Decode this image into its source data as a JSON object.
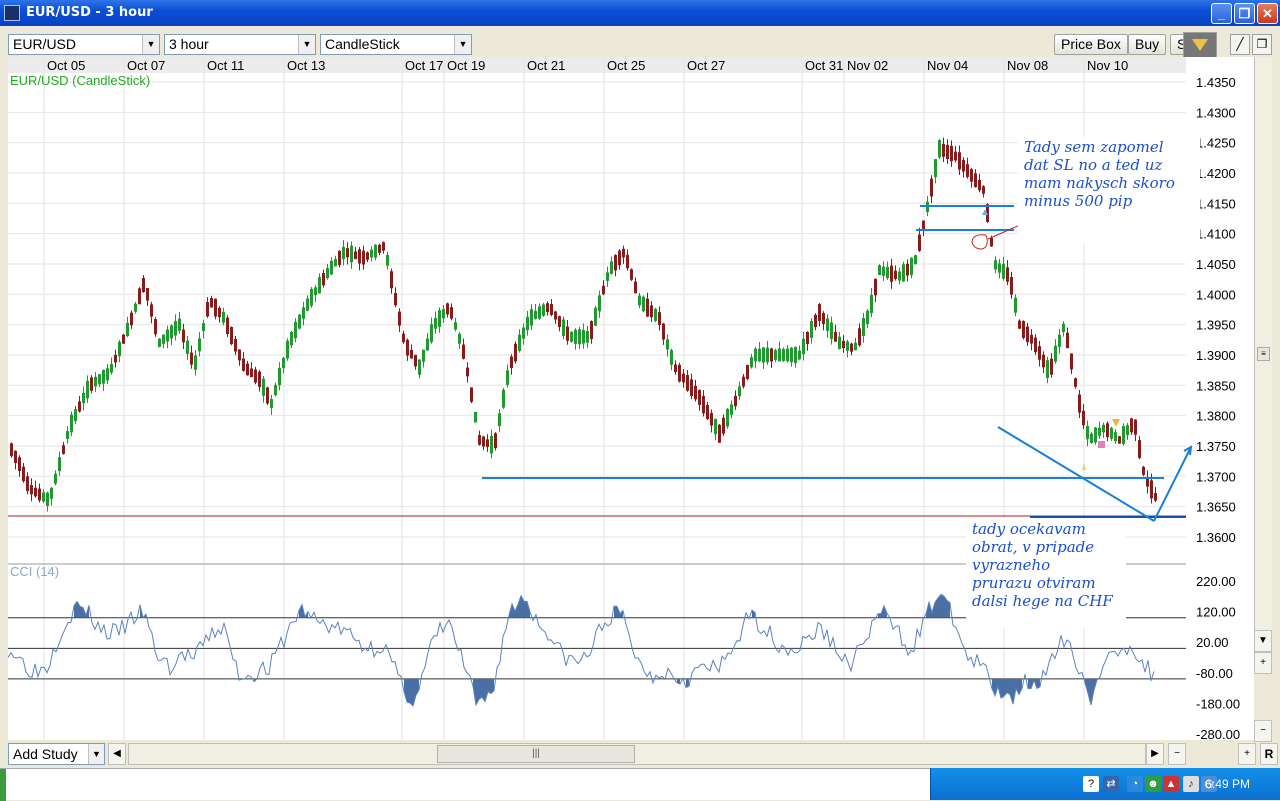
{
  "window": {
    "title": "EUR/USD - 3 hour"
  },
  "toolbar": {
    "symbol": "EUR/USD",
    "interval": "3 hour",
    "chart_type": "CandleStick",
    "price_box": "Price Box",
    "buy": "Buy",
    "sell": "Sell"
  },
  "chart": {
    "main_label": "EUR/USD (CandleStick)",
    "indicator_label": "CCI (14)",
    "date_labels": [
      "Oct 05",
      "Oct 07",
      "Oct 11",
      "Oct 13",
      "Oct 17",
      "Oct 19",
      "Oct 21",
      "Oct 25",
      "Oct 27",
      "Oct 31",
      "Nov 02",
      "Nov 04",
      "Nov 08",
      "Nov 10"
    ],
    "price_ticks": [
      "1.4350",
      "1.4300",
      "1.4250",
      "1.4200",
      "1.4150",
      "1.4100",
      "1.4050",
      "1.4000",
      "1.3950",
      "1.3900",
      "1.3850",
      "1.3800",
      "1.3750",
      "1.3700",
      "1.3650",
      "1.3600"
    ],
    "cci_ticks": [
      "220.00",
      "120.00",
      "20.00",
      "-80.00",
      "-180.00",
      "-280.00"
    ],
    "colors": {
      "up": "#1f9a2e",
      "down": "#8b1a1a",
      "annotation": "#1a50c8",
      "cci": "#4a6fa5",
      "label_green": "#22aa22"
    }
  },
  "chart_data": {
    "type": "candlestick",
    "title": "EUR/USD (CandleStick)",
    "interval": "3 hour",
    "x": [
      "Oct 05",
      "Oct 07",
      "Oct 11",
      "Oct 13",
      "Oct 17",
      "Oct 19",
      "Oct 21",
      "Oct 25",
      "Oct 27",
      "Oct 31",
      "Nov 02",
      "Nov 04",
      "Nov 08",
      "Nov 10"
    ],
    "close_approx": [
      1.37,
      1.4,
      1.385,
      1.41,
      1.392,
      1.375,
      1.399,
      1.402,
      1.376,
      1.393,
      1.41,
      1.423,
      1.39,
      1.366
    ],
    "ylim": [
      1.356,
      1.436
    ],
    "indicator": {
      "name": "CCI (14)",
      "ylim": [
        -280,
        220
      ],
      "levels": [
        100,
        0,
        -100
      ]
    }
  },
  "annotations": {
    "top": "Tady sem zapomel\ndat SL no  a ted uz\nmam nakysch skoro\nminus 500 pip",
    "bottom": "tady ocekavam\nobrat, v pripade\nvyrazneho\nprurazu otviram\ndalsi hege na CHF"
  },
  "bottom": {
    "add_study": "Add Study",
    "scroll_thumb": "|||"
  },
  "taskbar": {
    "clock": "6:49 PM"
  }
}
